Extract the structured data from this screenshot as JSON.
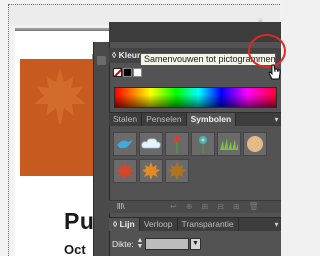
{
  "document": {
    "title": "Pu",
    "subtitle": "Oct"
  },
  "dock": {
    "header_menu": "≡"
  },
  "color_panel": {
    "tab_label": "Kleur",
    "collapse_glyph": "◊",
    "tooltip": "Samenvouwen tot pictogrammen"
  },
  "library_panel": {
    "tabs": [
      {
        "label": "Stalen"
      },
      {
        "label": "Penselen"
      },
      {
        "label": "Symbolen"
      }
    ],
    "menu_glyph": "▾",
    "library_glyph": "lll\\",
    "bottom_icons": [
      "↩",
      "⊕",
      "⊞",
      "⊟",
      "⊞",
      "🗑"
    ]
  },
  "stroke_panel": {
    "tabs": [
      {
        "label": "Lijn"
      },
      {
        "label": "Verloop"
      },
      {
        "label": "Transparantie"
      }
    ],
    "collapse_glyph": "◊",
    "weight_label": "Dikte:",
    "weight_value": "",
    "stepper_up": "▲",
    "stepper_down": "▼",
    "dropdown_glyph": "▼",
    "menu_glyph": "▾"
  },
  "colors": {
    "accent_orange": "#c75a1e",
    "panel_bg": "#535353",
    "callout_red": "#e12727"
  }
}
